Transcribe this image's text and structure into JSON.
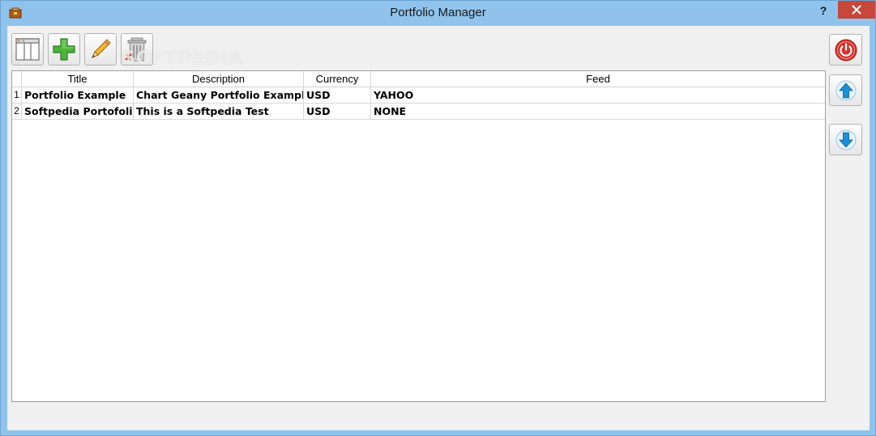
{
  "window": {
    "title": "Portfolio Manager",
    "help_label": "?",
    "close_label": "✕"
  },
  "toolbar": {
    "buttons": [
      {
        "name": "view",
        "icon": "window-layout-icon"
      },
      {
        "name": "add",
        "icon": "plus-icon"
      },
      {
        "name": "edit",
        "icon": "pencil-icon"
      },
      {
        "name": "delete",
        "icon": "trash-icon"
      }
    ]
  },
  "watermark": "SOFTPEDIA",
  "side_buttons": [
    {
      "name": "power",
      "icon": "power-icon"
    },
    {
      "name": "move-up",
      "icon": "arrow-up-icon"
    },
    {
      "name": "move-down",
      "icon": "arrow-down-icon"
    }
  ],
  "table": {
    "columns": [
      "Title",
      "Description",
      "Currency",
      "Feed"
    ],
    "rows": [
      {
        "num": "1",
        "title": "Portfolio Example",
        "description": "Chart Geany Portfolio Example",
        "currency": "USD",
        "feed": "YAHOO"
      },
      {
        "num": "2",
        "title": "Softpedia Portofolio",
        "description": "This is a Softpedia Test",
        "currency": "USD",
        "feed": "NONE"
      }
    ]
  },
  "colors": {
    "titlebar": "#8fc3ec",
    "close": "#c7473b",
    "power": "#d9302b",
    "arrow": "#1a8fd6",
    "plus": "#4cb33c"
  }
}
